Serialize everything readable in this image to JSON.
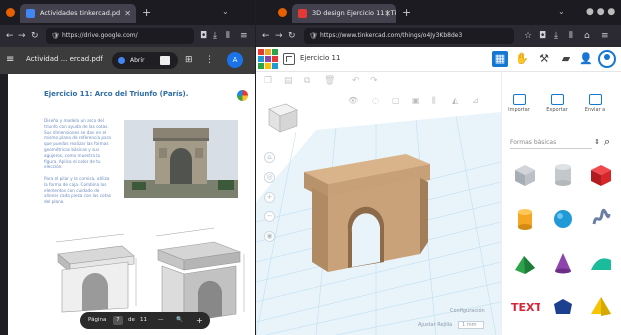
{
  "left_window": {
    "tab_title": "Actividades tinkercad.pd",
    "url": "https://drive.google.com/",
    "pdf_filename": "Actividad ... ercad.pdf",
    "open_with_label": "Abrir",
    "avatar_letter": "A",
    "exercise_title": "Ejercicio 11: Arco del Triunfo (París).",
    "paragraph_1": "Diseña y modela un arco del triunfo con ayuda de las cotas. Sus dimensiones se dan en el mismo plano de referencia para que puedas realizar las formas geométricas básicas y sus agujeros, como muestra la figura. Aplica el color de tu elección.",
    "paragraph_2": "Para el pilar y la cornisa, utiliza la forma de caja. Combina los elementos con cuidado de alinear cada pieza con las cotas del plano.",
    "pager": {
      "label": "Página",
      "current": "7",
      "separator": "de",
      "total": "11",
      "zoom_out": "—",
      "zoom_in": "+"
    }
  },
  "right_window": {
    "tab_title": "3D design Ejercicio 11 | Ti",
    "url": "https://www.tinkercad.com/things/o4Jy3Kb8de3",
    "design_name": "Ejercicio 11",
    "tool_icons": [
      "grid-view-icon",
      "hand-icon",
      "pickaxe-icon",
      "brick-icon",
      "add-user-icon"
    ],
    "panel_tabs": [
      "Importar",
      "Exportar",
      "Enviar a"
    ],
    "shape_category": "Formas básicas",
    "shapes": [
      {
        "name": "box-striped",
        "color": "#b0b6bd"
      },
      {
        "name": "cylinder-striped",
        "color": "#bfc3c8"
      },
      {
        "name": "box",
        "color": "#e0262a"
      },
      {
        "name": "cylinder",
        "color": "#f5a623"
      },
      {
        "name": "sphere",
        "color": "#1f9ad6"
      },
      {
        "name": "scribble",
        "color": "#6b7ea3"
      },
      {
        "name": "roof",
        "color": "#2aa34a"
      },
      {
        "name": "cone",
        "color": "#8e44ad"
      },
      {
        "name": "round-roof",
        "color": "#1abc9c"
      },
      {
        "name": "text",
        "color": "#d7243a"
      },
      {
        "name": "polygon",
        "color": "#1d3f8f"
      },
      {
        "name": "pyramid",
        "color": "#f6c400"
      }
    ],
    "settings_label": "Configuración",
    "snap_grid_label": "Ajustar Rejilla",
    "snap_grid_value": "1 mm",
    "arch_color": "#c8a077"
  }
}
